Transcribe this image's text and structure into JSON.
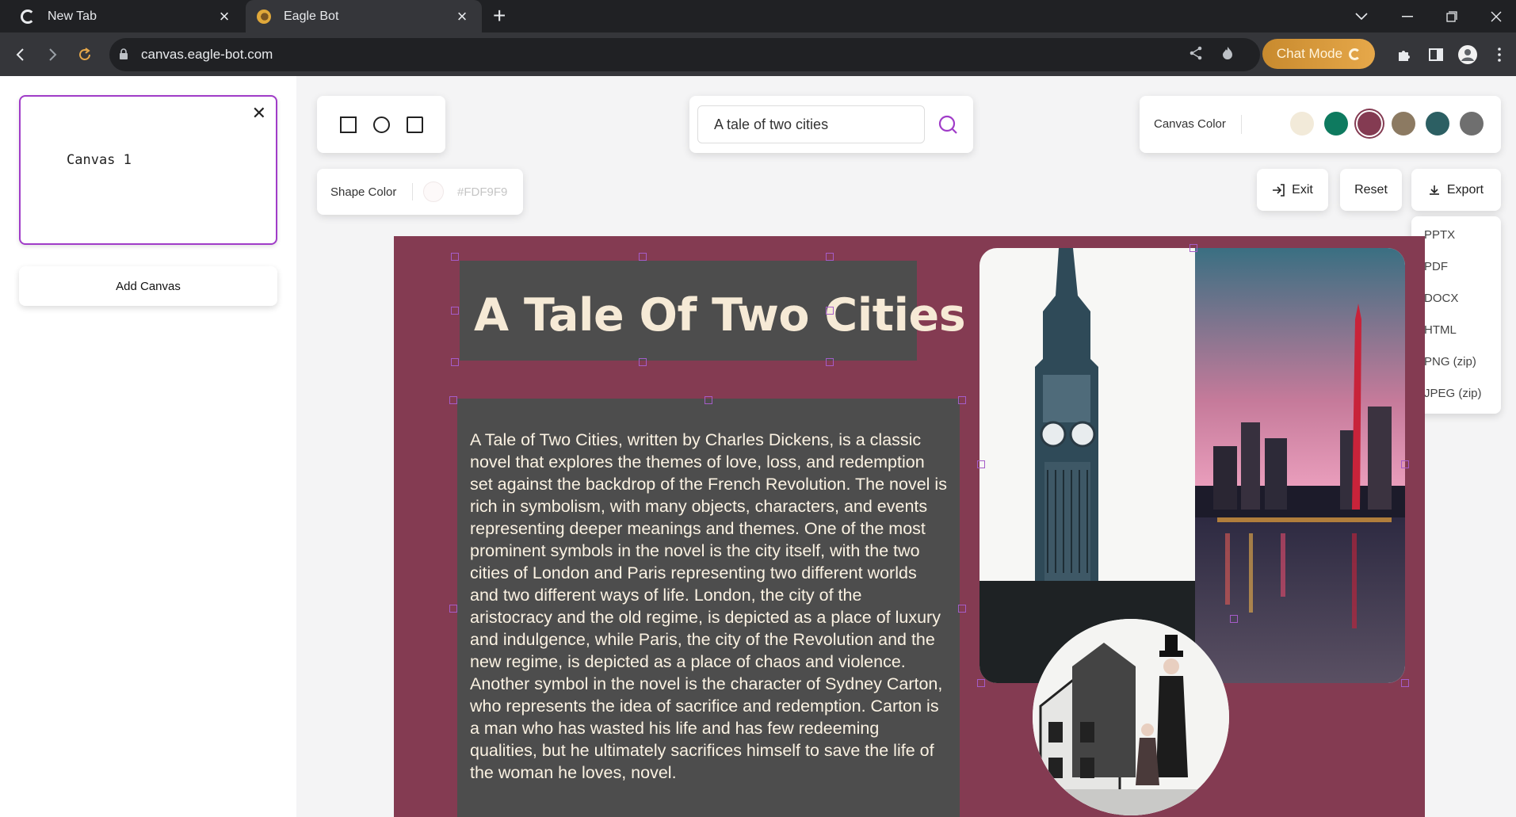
{
  "browser": {
    "tabs": [
      {
        "title": "New Tab",
        "active": false
      },
      {
        "title": "Eagle Bot",
        "active": true
      }
    ],
    "url": "canvas.eagle-bot.com",
    "chat_mode_label": "Chat Mode"
  },
  "sidebar": {
    "canvases": [
      {
        "name": "Canvas 1",
        "selected": true
      }
    ],
    "add_canvas_label": "Add Canvas"
  },
  "toolbar": {
    "search": {
      "value": "A tale of two cities"
    },
    "canvas_color_label": "Canvas Color",
    "canvas_colors": [
      "#f2ead9",
      "#0e7a5f",
      "#843b52",
      "#8c7a62",
      "#2c5f63",
      "#6f6f6f"
    ],
    "selected_canvas_color": "#843b52",
    "shape_color_label": "Shape Color",
    "shape_color_value": "#FDF9F9",
    "exit_label": "Exit",
    "reset_label": "Reset",
    "export_label": "Export",
    "export_options": [
      "PPTX",
      "PDF",
      "DOCX",
      "HTML",
      "PNG (zip)",
      "JPEG (zip)"
    ]
  },
  "slide": {
    "background": "#843b52",
    "title": "A Tale Of Two Cities",
    "body": "A Tale of Two Cities, written by Charles Dickens, is a classic novel that explores the themes of love, loss, and redemption set against the backdrop of the French Revolution. The novel is rich in symbolism, with many objects, characters, and events representing deeper meanings and themes. One of the most prominent symbols in the novel is the city itself, with the two cities of London and Paris representing two different worlds and two different ways of life. London, the city of the aristocracy and the old regime, is depicted as a place of luxury and indulgence, while Paris, the city of the Revolution and the new regime, is depicted as a place of chaos and violence. Another symbol in the novel is the character of Sydney Carton, who represents the idea of sacrifice and redemption. Carton is a man who has wasted his life and has few redeeming qualities, but he ultimately sacrifices himself to save the life of the woman he loves, novel."
  },
  "icons": {
    "back": "arrow-left-icon",
    "forward": "arrow-right-icon",
    "reload": "reload-icon",
    "share": "share-icon",
    "extensions": "puzzle-icon",
    "profile": "avatar-icon",
    "search": "search-icon",
    "export": "download-icon",
    "exit": "exit-icon"
  }
}
